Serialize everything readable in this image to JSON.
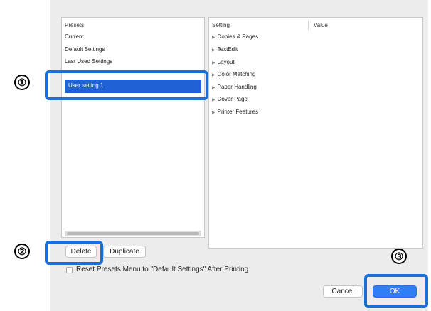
{
  "presets": {
    "header": "Presets",
    "items": [
      "Current",
      "Default Settings",
      "Last Used Settings"
    ],
    "selected": "User setting 1"
  },
  "settings": {
    "header_setting": "Setting",
    "header_value": "Value",
    "items": [
      "Copies & Pages",
      "TextEdit",
      "Layout",
      "Color Matching",
      "Paper Handling",
      "Cover Page",
      "Printer Features"
    ]
  },
  "buttons": {
    "delete": "Delete",
    "duplicate": "Duplicate",
    "cancel": "Cancel",
    "ok": "OK"
  },
  "checkbox_label": "Reset Presets Menu to \"Default Settings\" After Printing",
  "callouts": {
    "one": "①",
    "two": "②",
    "three": "③"
  },
  "colors": {
    "accent": "#1b6fd8",
    "selection": "#1f62d6",
    "primary_button": "#2f7ef6"
  }
}
